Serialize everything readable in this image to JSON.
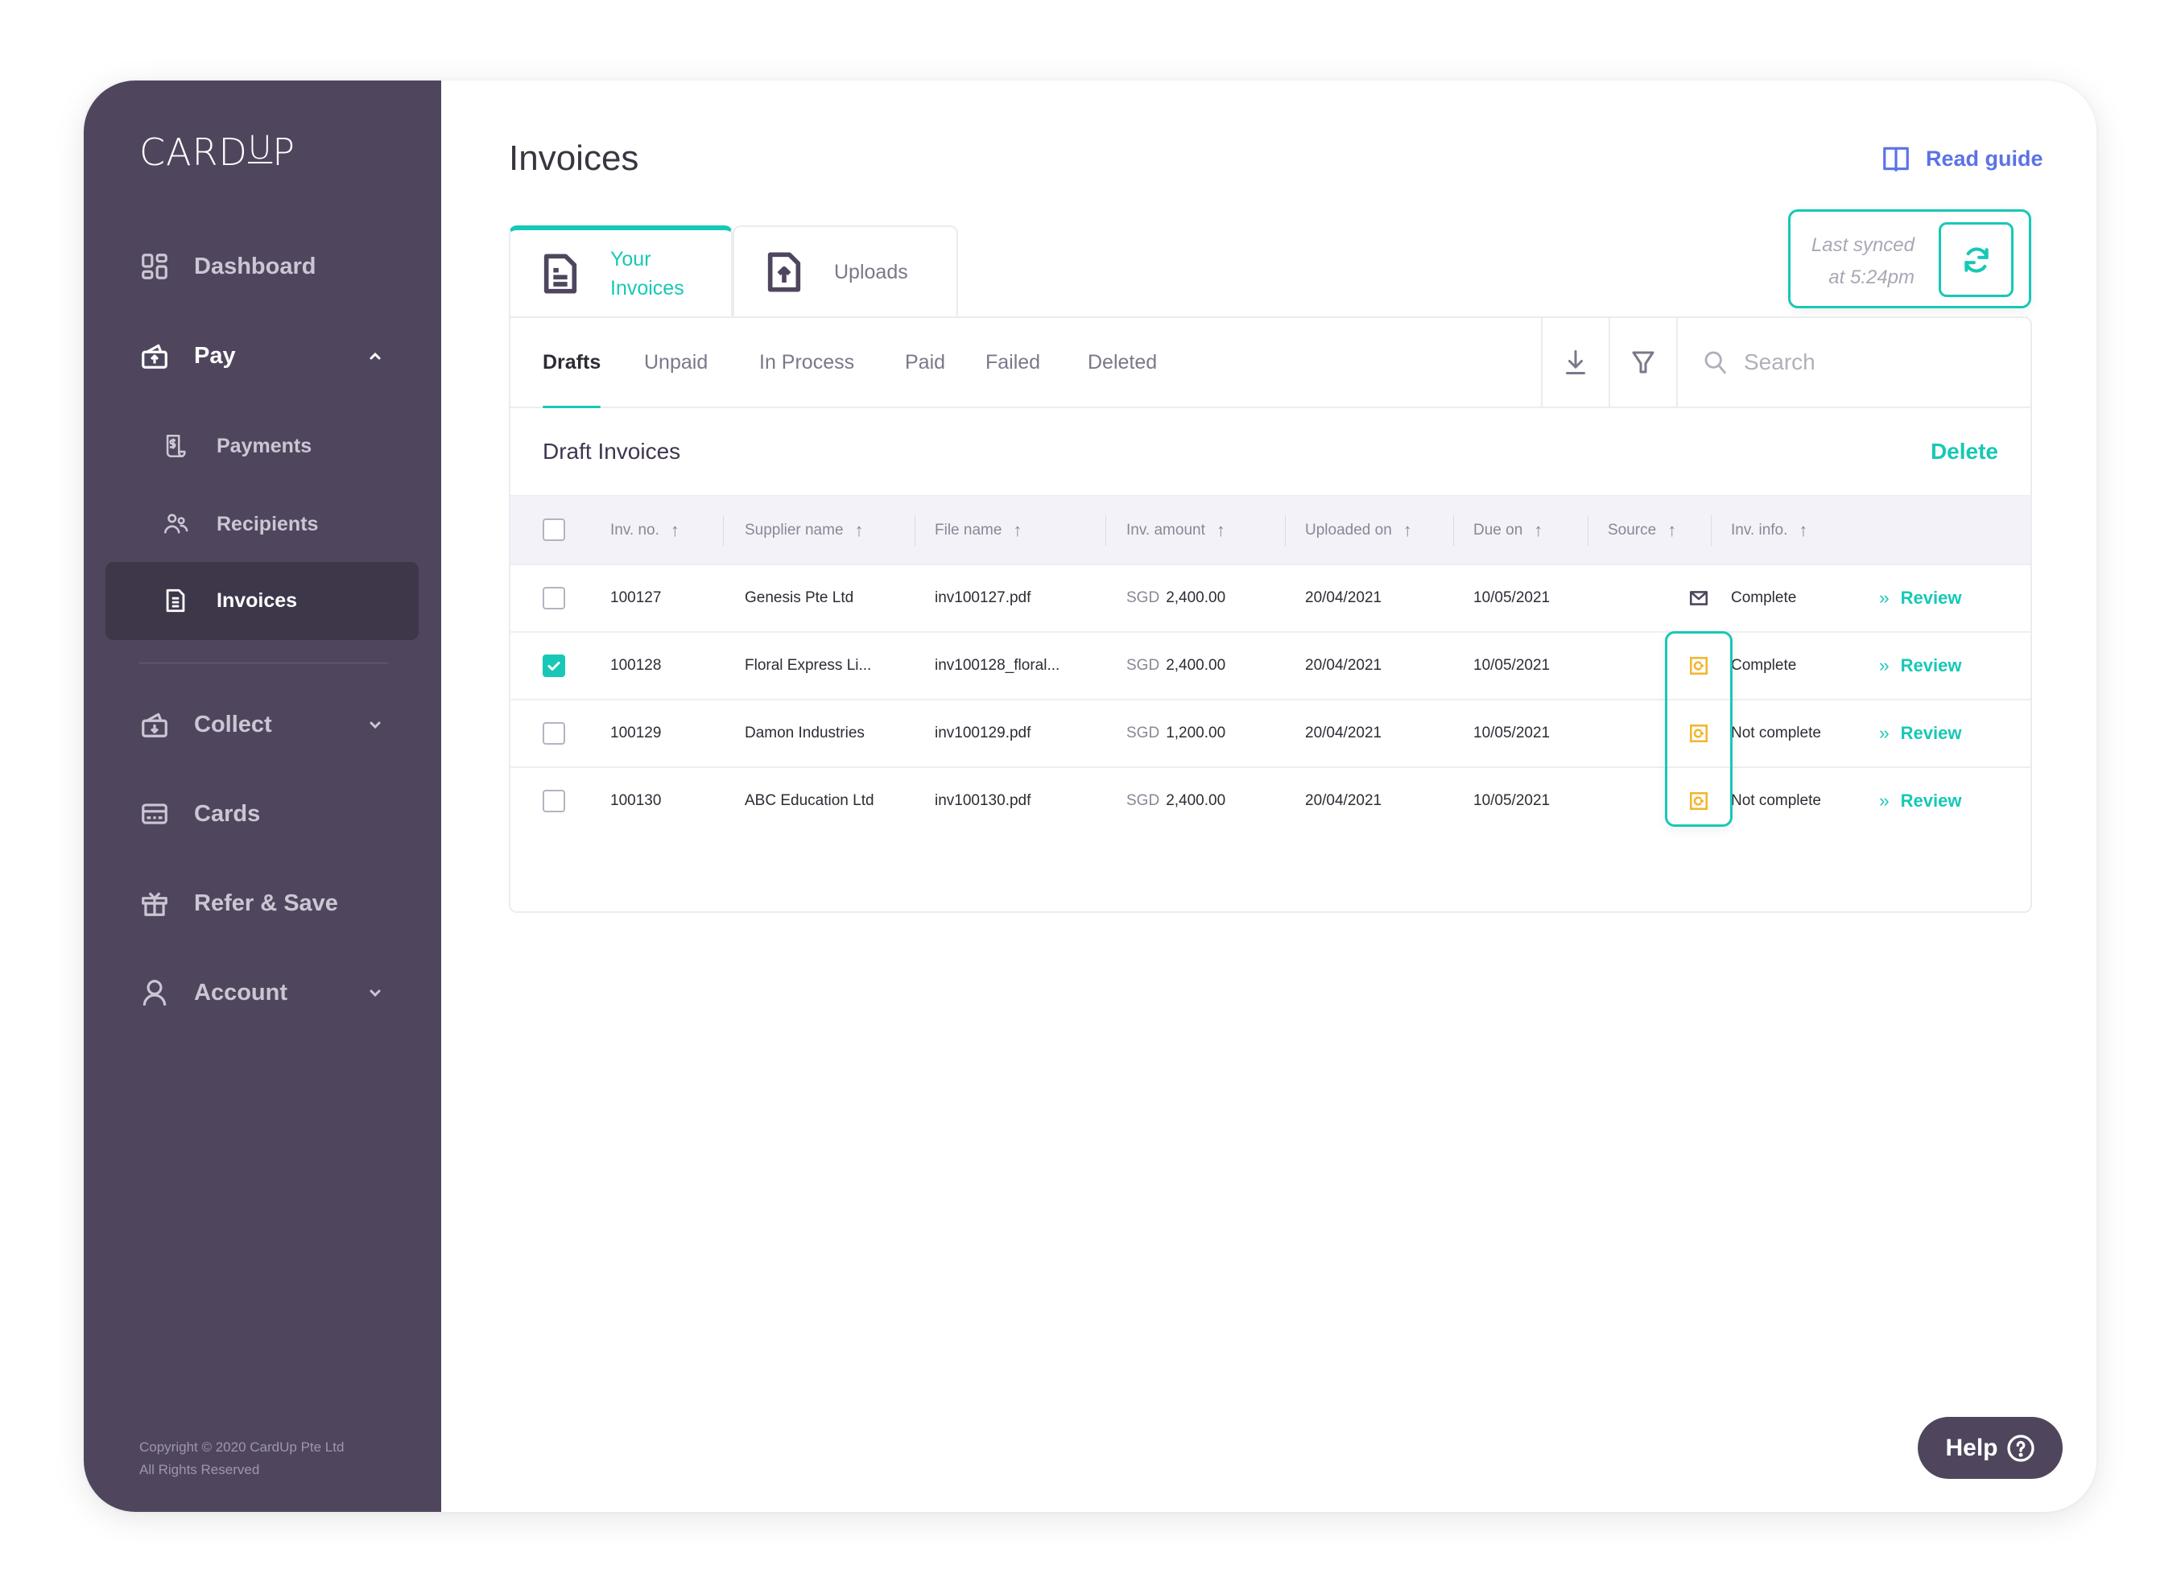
{
  "app": {
    "logo_text": "CARD",
    "logo_u": "U",
    "logo_end": "P"
  },
  "sidebar": {
    "items": [
      {
        "label": "Dashboard",
        "icon": "dashboard-icon"
      },
      {
        "label": "Pay",
        "icon": "pay-icon",
        "expanded": true
      },
      {
        "label": "Payments",
        "icon": "payments-icon"
      },
      {
        "label": "Recipients",
        "icon": "recipients-icon"
      },
      {
        "label": "Invoices",
        "icon": "invoices-icon",
        "active": true
      },
      {
        "label": "Collect",
        "icon": "collect-icon",
        "expanded": false
      },
      {
        "label": "Cards",
        "icon": "cards-icon"
      },
      {
        "label": "Refer & Save",
        "icon": "gift-icon"
      },
      {
        "label": "Account",
        "icon": "account-icon",
        "expanded": false
      }
    ],
    "copyright_line1": "Copyright © 2020 CardUp Pte Ltd",
    "copyright_line2": "All Rights Reserved"
  },
  "header": {
    "title": "Invoices",
    "read_guide": "Read guide",
    "sync_line1": "Last synced",
    "sync_line2": "at 5:24pm"
  },
  "tabs": [
    {
      "label": "Your Invoices",
      "active": true
    },
    {
      "label": "Uploads",
      "active": false
    }
  ],
  "filters": {
    "tabs": [
      "Drafts",
      "Unpaid",
      "In Process",
      "Paid",
      "Failed",
      "Deleted"
    ],
    "active": "Drafts",
    "search_placeholder": "Search"
  },
  "section": {
    "title": "Draft Invoices",
    "delete_label": "Delete"
  },
  "table": {
    "columns": [
      "Inv. no.",
      "Supplier name",
      "File name",
      "Inv. amount",
      "Uploaded on",
      "Due on",
      "Source",
      "Inv. info."
    ],
    "sort_indicator": "↑",
    "review_label": "Review",
    "review_chevron": "››",
    "rows": [
      {
        "checked": false,
        "inv_no": "100127",
        "supplier": "Genesis Pte Ltd",
        "file": "inv100127.pdf",
        "currency": "SGD",
        "amount": "2,400.00",
        "uploaded": "20/04/2021",
        "due": "10/05/2021",
        "source": "email",
        "info": "Complete"
      },
      {
        "checked": true,
        "inv_no": "100128",
        "supplier": "Floral Express Li...",
        "file": "inv100128_floral...",
        "currency": "SGD",
        "amount": "2,400.00",
        "uploaded": "20/04/2021",
        "due": "10/05/2021",
        "source": "cardup",
        "info": "Complete"
      },
      {
        "checked": false,
        "inv_no": "100129",
        "supplier": "Damon Industries",
        "file": "inv100129.pdf",
        "currency": "SGD",
        "amount": "1,200.00",
        "uploaded": "20/04/2021",
        "due": "10/05/2021",
        "source": "cardup",
        "info": "Not complete"
      },
      {
        "checked": false,
        "inv_no": "100130",
        "supplier": "ABC Education Ltd",
        "file": "inv100130.pdf",
        "currency": "SGD",
        "amount": "2,400.00",
        "uploaded": "20/04/2021",
        "due": "10/05/2021",
        "source": "cardup",
        "info": "Not complete"
      }
    ]
  },
  "help": {
    "label": "Help"
  },
  "colors": {
    "sidebar_bg": "#4f465e",
    "accent": "#17c8b6",
    "link_blue": "#5c72e6",
    "source_yellow": "#f2b632",
    "table_header_bg": "#f4f2f9"
  }
}
